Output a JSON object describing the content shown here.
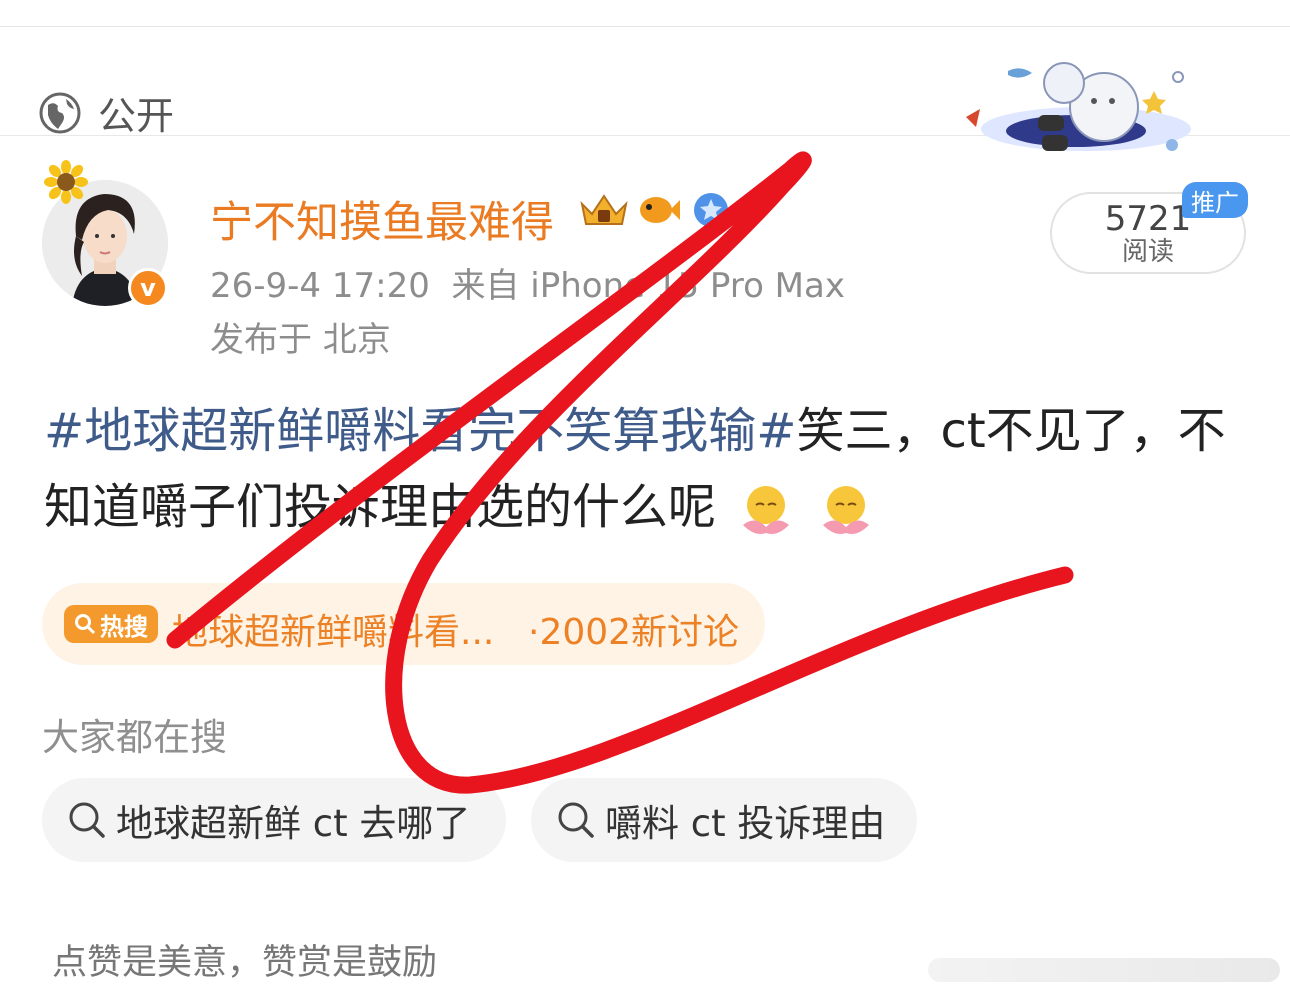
{
  "header": {
    "visibility_label": "公开",
    "visibility_icon": "globe-icon"
  },
  "user": {
    "name": "宁不知摸鱼最难得",
    "verified_mark": "v"
  },
  "post_meta": {
    "datetime": "26-9-4 17:20",
    "source": "来自 iPhone 15 Pro Max",
    "location": "发布于 北京"
  },
  "reads": {
    "count": "5721",
    "label": "阅读",
    "promo": "推广"
  },
  "post": {
    "topic": "#地球超新鲜嚼料看完不笑算我输#",
    "text": "笑三，ct不见了，不知道嚼子们投诉理由选的什么呢"
  },
  "hot_search": {
    "badge": "热搜",
    "title": "地球超新鲜嚼料看...",
    "count": "·2002新讨论"
  },
  "searches": {
    "label": "大家都在搜",
    "items": [
      "地球超新鲜 ct 去哪了",
      "嚼料 ct 投诉理由"
    ]
  },
  "footer": {
    "text": "点赞是美意，赞赏是鼓励"
  },
  "colors": {
    "username": "#ea7b22",
    "topic": "#3f5b8a",
    "hot": "#ec8125",
    "scribble": "#e8141e"
  }
}
